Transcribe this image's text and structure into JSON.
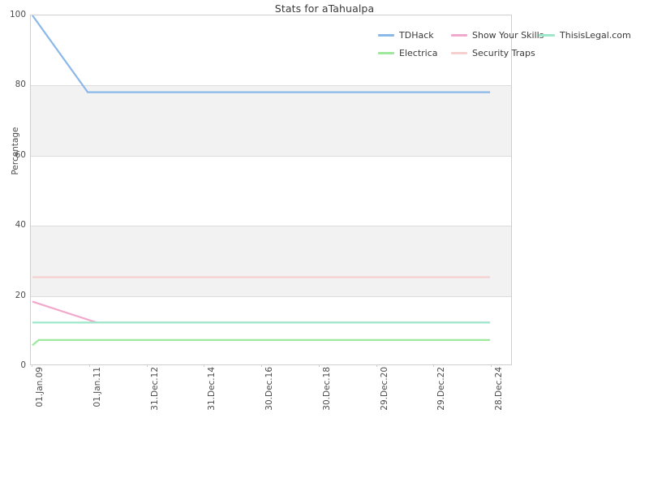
{
  "chart_data": {
    "type": "line",
    "title": "Stats for aTahualpa",
    "xlabel": "",
    "ylabel": "Percentage",
    "ylim": [
      0,
      100
    ],
    "yticks": [
      0,
      20,
      40,
      60,
      80,
      100
    ],
    "grid": true,
    "legend_position": "top-right",
    "x_tick_labels": [
      "01.Jan.09",
      "01.Jan.11",
      "31.Dec.12",
      "31.Dec.14",
      "30.Dec.16",
      "30.Dec.18",
      "29.Dec.20",
      "29.Dec.22",
      "28.Dec.24"
    ],
    "x_range": [
      "01.Jan.09",
      "28.Dec.24"
    ],
    "series": [
      {
        "name": "TDHack",
        "color": "#8ab8e8",
        "x": [
          "01.Jan.09",
          "07.Dec.10",
          "01.Jan.11",
          "28.Dec.24"
        ],
        "values": [
          100,
          78,
          78,
          78
        ]
      },
      {
        "name": "Electrica",
        "color": "#9ee89e",
        "x": [
          "01.Jan.09",
          "20.Mar.09",
          "28.Dec.24"
        ],
        "values": [
          5.5,
          7,
          7
        ]
      },
      {
        "name": "Show Your Skills",
        "color": "#f2a8cc",
        "x": [
          "01.Jan.09",
          "01.Apr.11",
          "28.Dec.24"
        ],
        "values": [
          18,
          12,
          12
        ]
      },
      {
        "name": "Security Traps",
        "color": "#f6cfcf",
        "x": [
          "01.Jan.09",
          "28.Dec.24"
        ],
        "values": [
          25,
          25
        ]
      },
      {
        "name": "ThisisLegal.com",
        "color": "#9de8cb",
        "x": [
          "01.Jan.09",
          "28.Dec.24"
        ],
        "values": [
          12,
          12
        ]
      }
    ]
  },
  "legend": {
    "entries": [
      {
        "label": "TDHack"
      },
      {
        "label": "Show Your Skills"
      },
      {
        "label": "ThisisLegal.com"
      },
      {
        "label": "Electrica"
      },
      {
        "label": "Security Traps"
      }
    ]
  },
  "colors": {
    "background": "#ffffff",
    "band": "#f2f2f2",
    "gridline": "#dcdcdc",
    "axis_border": "#cfcfcf",
    "text": "#4d4d4d",
    "title_text": "#3a3a3a"
  }
}
